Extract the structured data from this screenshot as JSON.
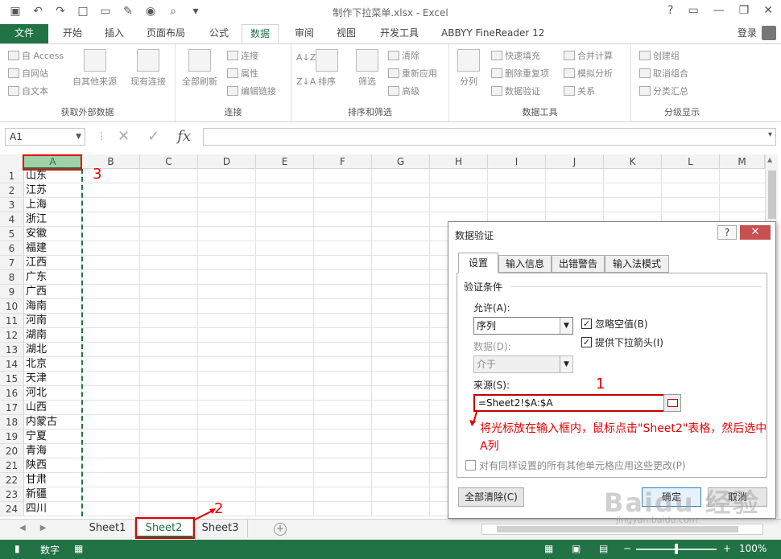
{
  "window": {
    "title": "制作下拉菜单.xlsx - Excel",
    "help": "?",
    "minimize": "—",
    "restore": "❐",
    "close": "✕"
  },
  "qat": {
    "save_icon": "save-icon",
    "undo_icon": "undo-icon",
    "redo_icon": "redo-icon"
  },
  "tabs": [
    "文件",
    "开始",
    "插入",
    "页面布局",
    "公式",
    "数据",
    "审阅",
    "视图",
    "开发工具",
    "ABBYY FineReader 12"
  ],
  "login": "登录",
  "ribbon": {
    "get_external": {
      "label": "获取外部数据",
      "access": "自 Access",
      "web": "自网站",
      "text": "自文本",
      "other": "自其他来源",
      "existing": "现有连接"
    },
    "connections": {
      "label": "连接",
      "refresh_all": "全部刷新",
      "connections": "连接",
      "properties": "属性",
      "edit_links": "编辑链接"
    },
    "sort_filter": {
      "label": "排序和筛选",
      "sort": "排序",
      "filter": "筛选",
      "clear": "清除",
      "reapply": "重新应用",
      "advanced": "高级"
    },
    "data_tools": {
      "label": "数据工具",
      "split": "分列",
      "flash_fill": "快速填充",
      "remove_dup": "删除重复项",
      "validation": "数据验证",
      "consolidate": "合并计算",
      "whatif": "模拟分析",
      "relationships": "关系"
    },
    "outline": {
      "label": "分级显示",
      "group": "创建组",
      "ungroup": "取消组合",
      "subtotal": "分类汇总"
    }
  },
  "formula_bar": {
    "name_box": "A1",
    "formula": ""
  },
  "sheet": {
    "columns": [
      "A",
      "B",
      "C",
      "D",
      "E",
      "F",
      "G",
      "H",
      "I",
      "J",
      "K",
      "L",
      "M"
    ],
    "rows": [
      "1",
      "2",
      "3",
      "4",
      "5",
      "6",
      "7",
      "8",
      "9",
      "10",
      "11",
      "12",
      "13",
      "14",
      "15",
      "16",
      "17",
      "18",
      "19",
      "20",
      "21",
      "22",
      "23",
      "24"
    ],
    "col_a": [
      "山东",
      "江苏",
      "上海",
      "浙江",
      "安徽",
      "福建",
      "江西",
      "广东",
      "广西",
      "海南",
      "河南",
      "湖南",
      "湖北",
      "北京",
      "天津",
      "河北",
      "山西",
      "内蒙古",
      "宁夏",
      "青海",
      "陕西",
      "甘肃",
      "新疆",
      "四川"
    ]
  },
  "sheet_tabs": [
    "Sheet1",
    "Sheet2",
    "Sheet3"
  ],
  "status": {
    "mode": "数字",
    "zoom": "100%"
  },
  "dialog": {
    "title": "数据验证",
    "help": "?",
    "close": "✕",
    "tabs": [
      "设置",
      "输入信息",
      "出错警告",
      "输入法模式"
    ],
    "criteria_title": "验证条件",
    "allow_label": "允许(A):",
    "allow_value": "序列",
    "data_label": "数据(D):",
    "data_value": "介于",
    "ignore_blank": "忽略空值(B)",
    "dropdown": "提供下拉箭头(I)",
    "source_label": "来源(S):",
    "source_value": "=Sheet2!$A:$A",
    "apply_all": "对有同样设置的所有其他单元格应用这些更改(P)",
    "clear_all": "全部清除(C)",
    "ok": "确定",
    "cancel": "取消"
  },
  "annotations": {
    "n1": "1",
    "n2": "2",
    "n3": "3",
    "note": "将光标放在输入框内，鼠标点击\"Sheet2\"表格，然后选中A列"
  },
  "watermark": {
    "brand": "Baidu 经验",
    "url": "jingyan.baidu.com"
  }
}
